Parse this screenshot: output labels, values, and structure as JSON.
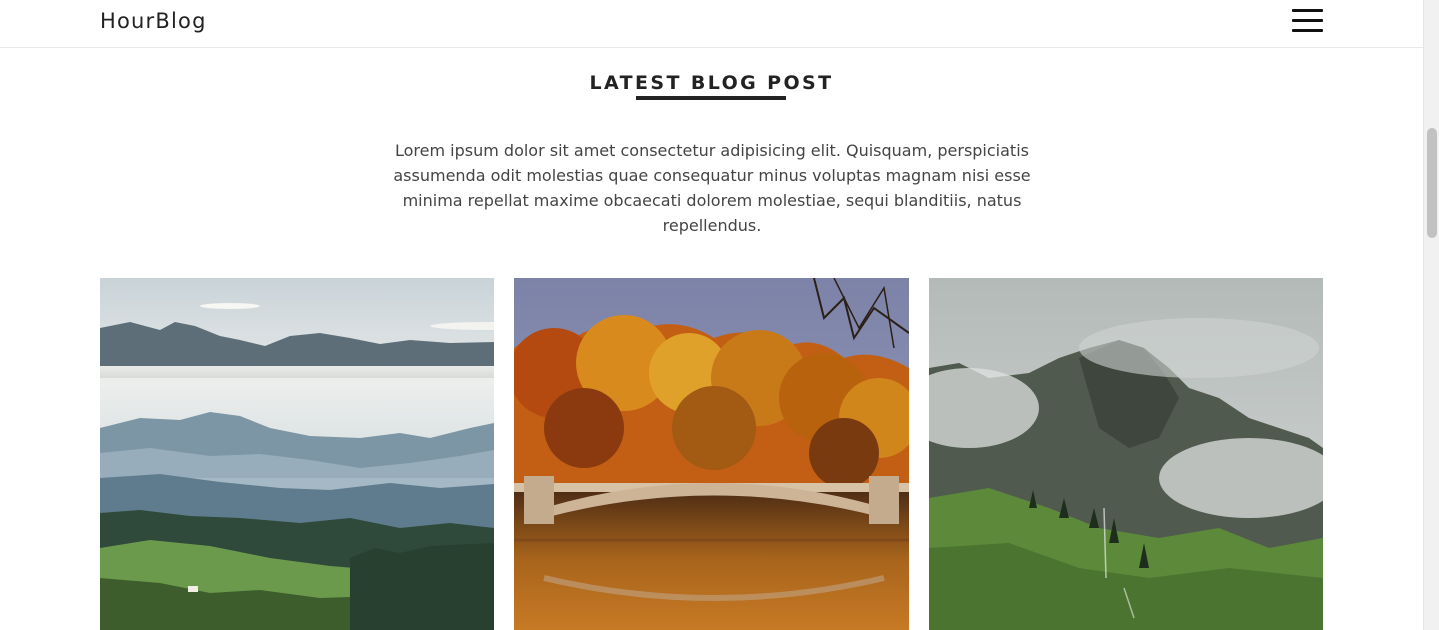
{
  "header": {
    "logo": "HourBlog",
    "menu_icon": "hamburger-menu-icon"
  },
  "section": {
    "title": "LATEST BLOG POST",
    "intro": "Lorem ipsum dolor sit amet consectetur adipisicing elit. Quisquam, perspiciatis assumenda odit molestias quae consequatur minus voluptas magnam nisi esse minima repellat maxime obcaecati dolorem molestiae, sequi blanditiis, natus repellendus."
  },
  "posts": [
    {
      "image": "misty-mountain-valley-image"
    },
    {
      "image": "autumn-bridge-lake-image"
    },
    {
      "image": "foggy-green-mountain-image"
    }
  ],
  "colors": {
    "text_dark": "#222222",
    "text_body": "#444444",
    "header_border": "#e9e9e9"
  }
}
